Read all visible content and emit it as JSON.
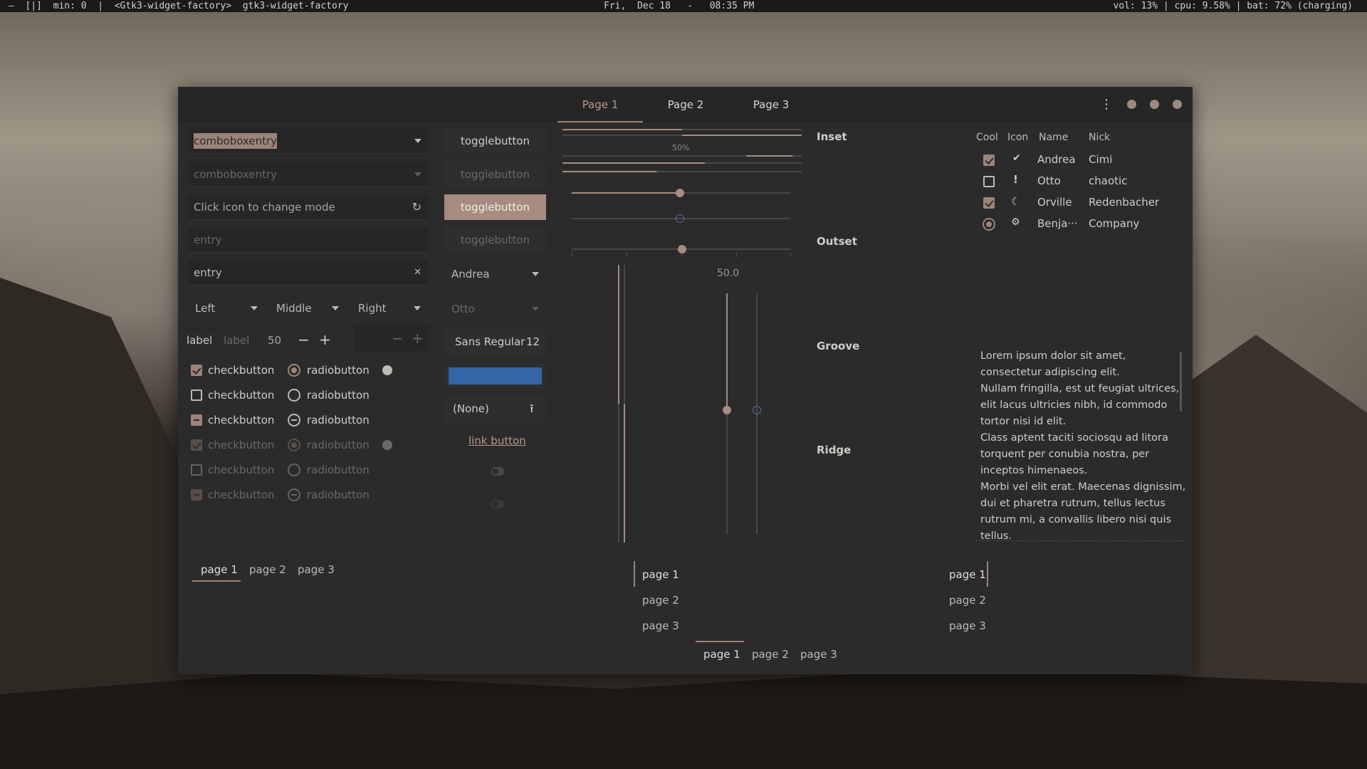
{
  "topbar": {
    "left": "—  [|]  min: 0  |  <Gtk3-widget-factory>  gtk3-widget-factory",
    "center": "Fri,  Dec 18   -   08:35 PM",
    "right": "vol: 13% | cpu: 9.58% | bat: 72% (charging)"
  },
  "header": {
    "tabs": [
      "Page 1",
      "Page 2",
      "Page 3"
    ],
    "active_tab": "Page 1",
    "menu_icon": "vertical-dots-icon"
  },
  "left": {
    "combo_entry": "comboboxentry",
    "combo_entry_disabled": "comboboxentry",
    "mode_entry_placeholder": "Click icon to change mode",
    "entry_disabled": "entry",
    "entry_clear": "entry",
    "combos": [
      "Left",
      "Middle",
      "Right"
    ],
    "label1": "label",
    "label2": "label",
    "spin_value": "50",
    "checks": [
      {
        "label": "checkbutton",
        "state": "checked",
        "disabled": false
      },
      {
        "label": "checkbutton",
        "state": "unchecked",
        "disabled": false
      },
      {
        "label": "checkbutton",
        "state": "mixed",
        "disabled": false
      },
      {
        "label": "checkbutton",
        "state": "checked",
        "disabled": true
      },
      {
        "label": "checkbutton",
        "state": "unchecked",
        "disabled": true
      },
      {
        "label": "checkbutton",
        "state": "mixed",
        "disabled": true
      }
    ],
    "radios": [
      {
        "label": "radiobutton",
        "state": "checked",
        "disabled": false
      },
      {
        "label": "radiobutton",
        "state": "unchecked",
        "disabled": false
      },
      {
        "label": "radiobutton",
        "state": "mixed",
        "disabled": false
      },
      {
        "label": "radiobutton",
        "state": "checked",
        "disabled": true
      },
      {
        "label": "radiobutton",
        "state": "unchecked",
        "disabled": true
      },
      {
        "label": "radiobutton",
        "state": "mixed",
        "disabled": true
      }
    ],
    "notebook_tabs": [
      "page 1",
      "page 2",
      "page 3"
    ]
  },
  "middle": {
    "togglebuttons": [
      "togglebutton",
      "togglebutton",
      "togglebutton",
      "togglebutton"
    ],
    "combo1": "Andrea",
    "combo2": "Otto",
    "font_name": "Sans Regular",
    "font_size": "12",
    "color_value": "#3465a4",
    "file_chooser": "(None)",
    "link_button": "link button"
  },
  "sliders": {
    "progress_label": "50%",
    "scale_value": "50.0"
  },
  "frames": [
    "Inset",
    "Outset",
    "Groove",
    "Ridge"
  ],
  "table": {
    "headers": [
      "Cool",
      "Icon",
      "Name",
      "Nick"
    ],
    "rows": [
      {
        "cool": "checked",
        "icon": "check-circle-icon",
        "name": "Andrea",
        "nick": "Cimi"
      },
      {
        "cool": "unchecked",
        "icon": "exclamation-circle-icon",
        "name": "Otto",
        "nick": "chaotic"
      },
      {
        "cool": "checked",
        "icon": "moon-icon",
        "name": "Orville",
        "nick": "Redenbacher"
      },
      {
        "cool": "radio",
        "icon": "gear-face-icon",
        "name": "Benja···",
        "nick": "Company"
      }
    ]
  },
  "textview": {
    "lines": [
      "Lorem ipsum dolor sit amet,",
      "consectetur adipiscing elit.",
      "Nullam fringilla, est ut feugiat ultrices,",
      "elit lacus ultricies nibh, id commodo",
      "tortor nisi id elit.",
      "Class aptent taciti sociosqu ad litora",
      "torquent per conubia nostra, per",
      "inceptos himenaeos.",
      "Morbi vel elit erat. Maecenas dignissim,",
      "dui et pharetra rutrum, tellus lectus",
      "rutrum mi, a convallis libero nisi quis",
      "tellus."
    ]
  },
  "notebooks": {
    "left_tabs": [
      "page 1",
      "page 2",
      "page 3"
    ],
    "right_tabs": [
      "page 1",
      "page 2",
      "page 3"
    ],
    "bottom_tabs": [
      "page 1",
      "page 2",
      "page 3"
    ]
  }
}
